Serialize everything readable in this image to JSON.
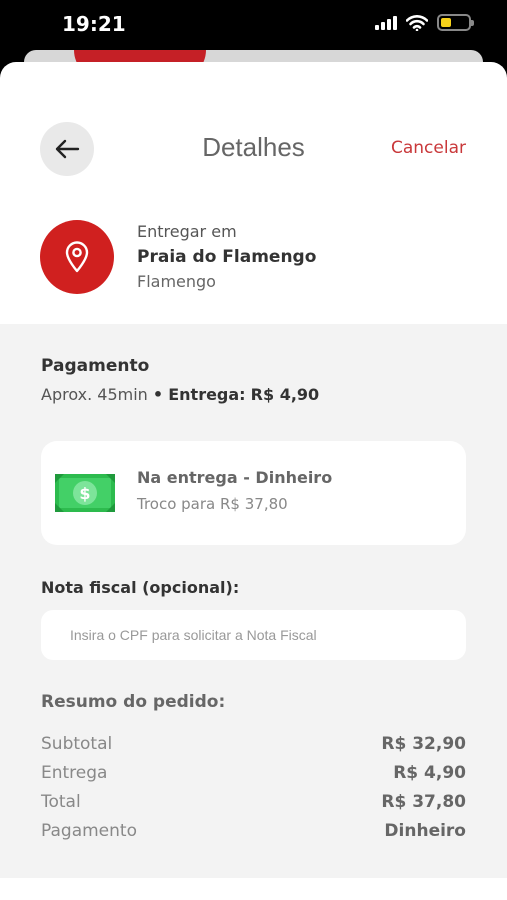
{
  "status_bar": {
    "time": "19:21",
    "signal_icon": "signal-icon",
    "wifi_icon": "wifi-icon",
    "battery_icon": "battery-icon",
    "battery_color": "#f7d21a"
  },
  "header": {
    "back_icon": "arrow-left-icon",
    "title": "Detalhes",
    "cancel_label": "Cancelar"
  },
  "address": {
    "icon": "location-pin-icon",
    "label": "Entregar em",
    "name": "Praia do Flamengo",
    "district": "Flamengo"
  },
  "payment": {
    "title": "Pagamento",
    "eta": "Aprox. 45min",
    "separator": "•",
    "delivery_label": "Entrega:",
    "delivery_fee": "R$ 4,90",
    "method": {
      "icon": "cash-icon",
      "name": "Na entrega - Dinheiro",
      "change": "Troco para R$ 37,80"
    }
  },
  "invoice": {
    "title": "Nota fiscal (opcional):",
    "placeholder": "Insira o CPF para solicitar a Nota Fiscal",
    "value": ""
  },
  "summary": {
    "title": "Resumo do pedido:",
    "rows": [
      {
        "label": "Subtotal",
        "value": "R$ 32,90"
      },
      {
        "label": "Entrega",
        "value": "R$ 4,90"
      },
      {
        "label": "Total",
        "value": "R$ 37,80"
      },
      {
        "label": "Pagamento",
        "value": "Dinheiro"
      }
    ]
  },
  "colors": {
    "accent_red": "#d0201f",
    "cancel_red": "#c9383a",
    "money_green": "#2dbb4e",
    "background_gray": "#f3f3f3"
  }
}
